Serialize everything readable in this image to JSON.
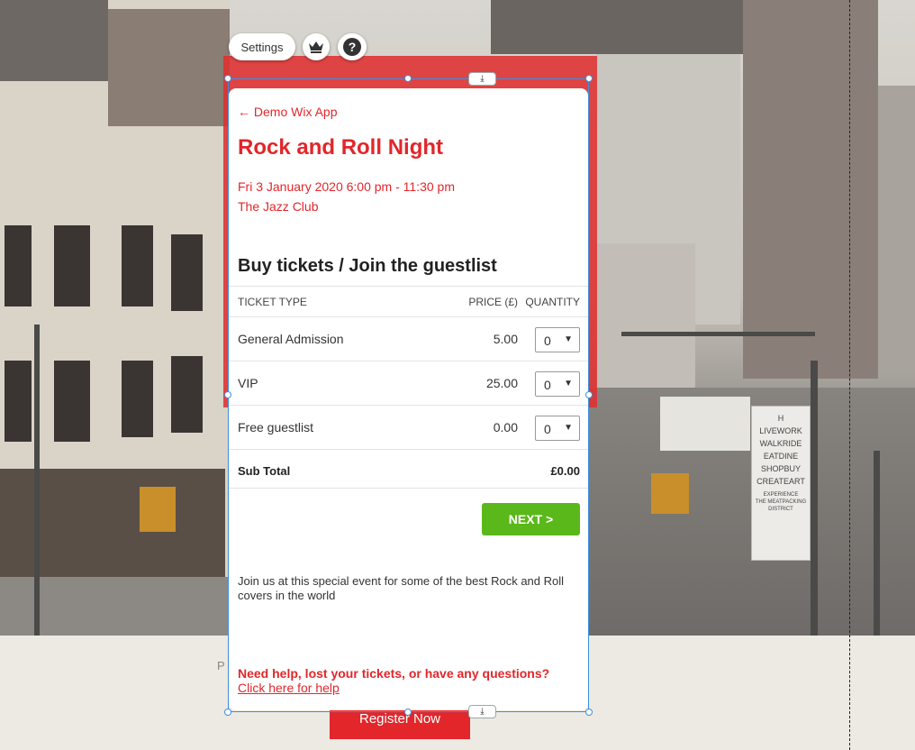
{
  "toolbar": {
    "settings_label": "Settings",
    "crown_icon": "crown-icon",
    "help_icon": "question-icon",
    "help_glyph": "?"
  },
  "event": {
    "back_label": "← Demo Wix App",
    "title": "Rock and Roll Night",
    "date": "Fri 3 January 2020 6:00 pm - 11:30 pm",
    "venue": "The Jazz Club"
  },
  "tickets": {
    "heading": "Buy tickets / Join the guestlist",
    "columns": {
      "type": "TICKET TYPE",
      "price": "PRICE (£)",
      "quantity": "QUANTITY"
    },
    "rows": [
      {
        "name": "General Admission",
        "price": "5.00",
        "qty": "0"
      },
      {
        "name": "VIP",
        "price": "25.00",
        "qty": "0"
      },
      {
        "name": "Free guestlist",
        "price": "0.00",
        "qty": "0"
      }
    ],
    "subtotal_label": "Sub Total",
    "subtotal_value": "£0.00",
    "next_label": "NEXT >"
  },
  "description": "Join us at this special event for some of the best Rock and Roll covers in the world",
  "help": {
    "question": "Need help, lost your tickets, or have any questions?",
    "link": "Click here for help"
  },
  "page": {
    "partial_text": "P",
    "register_label": "Register Now"
  },
  "street_sign": {
    "lines": [
      "LIVEWORK",
      "WALKRIDE",
      "EATDINE",
      "SHOPBUY",
      "CREATEART"
    ],
    "small_lines": [
      "EXPERIENCE",
      "THE MEATPACKING",
      "DISTRICT"
    ],
    "logo": "H"
  },
  "colors": {
    "accent_red": "#e2262a",
    "next_green": "#5bb81a",
    "selection_blue": "#3e8fe0"
  }
}
